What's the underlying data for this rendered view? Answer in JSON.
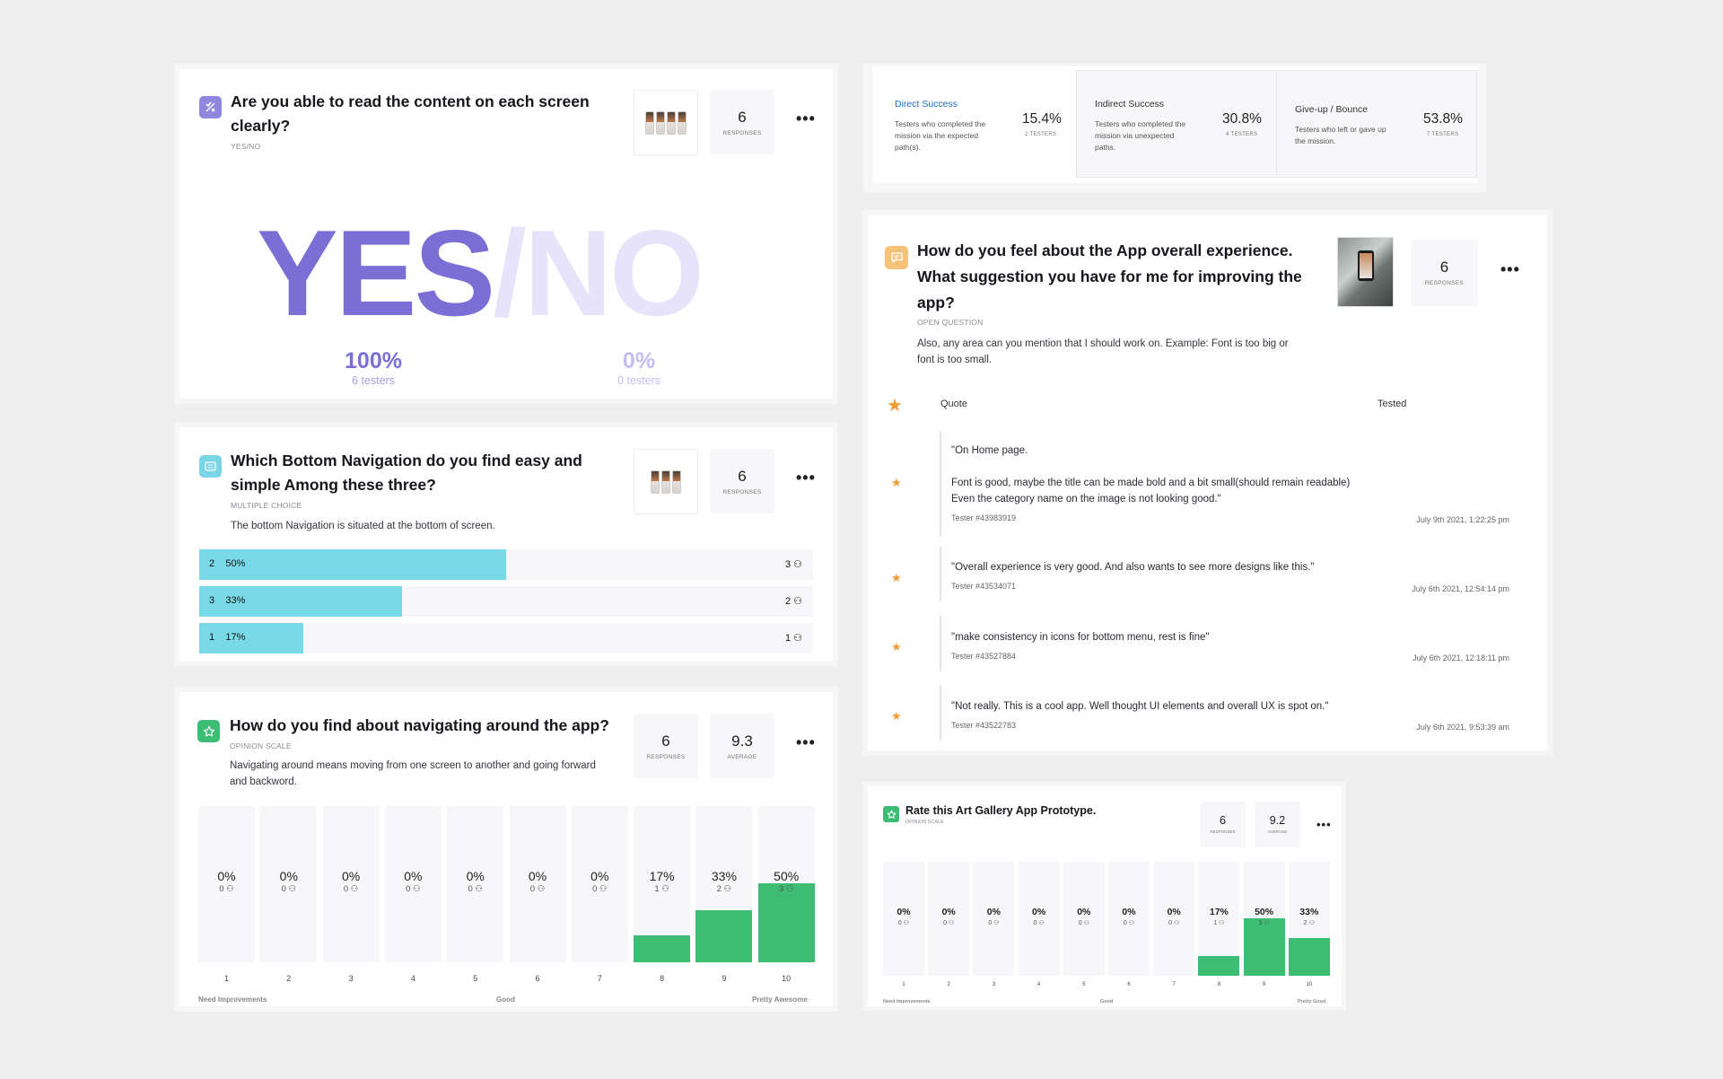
{
  "q1": {
    "title_line1": "Are you able to read the content on each screen",
    "title_line2": "clearly?",
    "type": "YES/NO",
    "responses": "6",
    "responses_label": "RESPONSES",
    "yes_word": "YES",
    "slash": "/",
    "no_word": "NO",
    "yes_pct": "100%",
    "yes_testers": "6 testers",
    "no_pct": "0%",
    "no_testers": "0 testers",
    "accent": "#7b6fd6",
    "accent_light": "#e6e3fa",
    "icon": "yes-no-icon"
  },
  "mission": {
    "direct": {
      "title": "Direct Success",
      "desc_line1": "Testers who completed the",
      "desc_line2": "mission via the expected",
      "desc_line3": "path(s).",
      "pct": "15.4%",
      "testers": "2 TESTERS"
    },
    "indirect": {
      "title": "Indirect Success",
      "desc_line1": "Testers who completed the",
      "desc_line2": "mission via unexpected",
      "desc_line3": "paths.",
      "pct": "30.8%",
      "testers": "4 TESTERS"
    },
    "giveup": {
      "title": "Give-up / Bounce",
      "desc_line1": "Testers who left or gave up",
      "desc_line2": "the mission.",
      "pct": "53.8%",
      "testers": "7 TESTERS"
    },
    "active_color": "#1f6fc8"
  },
  "q2": {
    "title_line1": "Which Bottom Navigation do you find easy and",
    "title_line2": "simple Among these three?",
    "type": "MULTIPLE CHOICE",
    "desc": "The bottom Navigation is situated at the bottom of screen.",
    "responses": "6",
    "responses_label": "RESPONSES",
    "icon": "list-icon",
    "rows": [
      {
        "option": "2",
        "pct_label": "50%",
        "fraction": 0.5,
        "count": "3"
      },
      {
        "option": "3",
        "pct_label": "33%",
        "fraction": 0.33,
        "count": "2"
      },
      {
        "option": "1",
        "pct_label": "17%",
        "fraction": 0.17,
        "count": "1"
      }
    ]
  },
  "q3": {
    "title": "How do you find about navigating around the app?",
    "type": "OPINION SCALE",
    "desc_line1": "Navigating around means moving from one screen to another and going forward",
    "desc_line2": "and backword.",
    "responses": "6",
    "responses_label": "RESPONSES",
    "average": "9.3",
    "average_label": "AVERAGE",
    "icon": "star-icon",
    "low_label": "Need Improvements",
    "mid_label": "Good",
    "high_label": "Pretty Awesome"
  },
  "q4": {
    "title_line1": "How do you feel about the App overall experience.",
    "title_line2": "What suggestion you have for me for improving the",
    "title_line3": "app?",
    "type": "OPEN QUESTION",
    "desc_line1": "Also, any area can you mention that I should work on. Example: Font is too big or",
    "desc_line2": "font is too small.",
    "responses": "6",
    "responses_label": "RESPONSES",
    "icon": "chat-icon",
    "col_quote": "Quote",
    "col_tested": "Tested",
    "quotes": [
      {
        "line1": "\"On Home page.",
        "line2": "",
        "line3": "Font is good, maybe the title can be made bold and a bit small(should remain readable)",
        "line4": "Even the category name on the image is not looking good.\"",
        "tester": "Tester #43983919",
        "date": "July 9th 2021, 1:22:25 pm"
      },
      {
        "line1": "\"Overall experience is very good. And also wants to see more designs like this.\"",
        "tester": "Tester #43534071",
        "date": "July 6th 2021, 12:54:14 pm"
      },
      {
        "line1": "\"make consistency in icons for bottom menu, rest is fine\"",
        "tester": "Tester #43527884",
        "date": "July 6th 2021, 12:18:11 pm"
      },
      {
        "line1": "\"Not really. This is a cool app. Well thought UI elements and overall UX is spot on.\"",
        "tester": "Tester #43522783",
        "date": "July 6th 2021, 9:53:39 am"
      }
    ]
  },
  "q5": {
    "title": "Rate this Art Gallery App Prototype.",
    "type": "OPINION SCALE",
    "responses": "6",
    "responses_label": "RESPONSES",
    "average": "9.2",
    "average_label": "AVERAGE",
    "icon": "star-icon",
    "low_label": "Need Improvements",
    "mid_label": "Good",
    "high_label": "Pretty Good"
  },
  "chart_data": [
    {
      "type": "bar",
      "title": "How do you find about navigating around the app?",
      "categories": [
        "1",
        "2",
        "3",
        "4",
        "5",
        "6",
        "7",
        "8",
        "9",
        "10"
      ],
      "values": [
        0,
        0,
        0,
        0,
        0,
        0,
        0,
        17,
        33,
        50
      ],
      "counts": [
        0,
        0,
        0,
        0,
        0,
        0,
        0,
        1,
        2,
        3
      ],
      "value_labels": [
        "0%",
        "0%",
        "0%",
        "0%",
        "0%",
        "0%",
        "0%",
        "17%",
        "33%",
        "50%"
      ],
      "count_labels": [
        "0",
        "0",
        "0",
        "0",
        "0",
        "0",
        "0",
        "1",
        "2",
        "3"
      ],
      "ylim": [
        0,
        50
      ],
      "color": "#3dbc73"
    },
    {
      "type": "bar",
      "title": "Rate this Art Gallery App Prototype.",
      "categories": [
        "1",
        "2",
        "3",
        "4",
        "5",
        "6",
        "7",
        "8",
        "9",
        "10"
      ],
      "values": [
        0,
        0,
        0,
        0,
        0,
        0,
        0,
        17,
        50,
        33
      ],
      "counts": [
        0,
        0,
        0,
        0,
        0,
        0,
        0,
        1,
        3,
        2
      ],
      "value_labels": [
        "0%",
        "0%",
        "0%",
        "0%",
        "0%",
        "0%",
        "0%",
        "17%",
        "50%",
        "33%"
      ],
      "count_labels": [
        "0",
        "0",
        "0",
        "0",
        "0",
        "0",
        "0",
        "1",
        "3",
        "2"
      ],
      "ylim": [
        0,
        50
      ],
      "color": "#3dbc73"
    }
  ]
}
